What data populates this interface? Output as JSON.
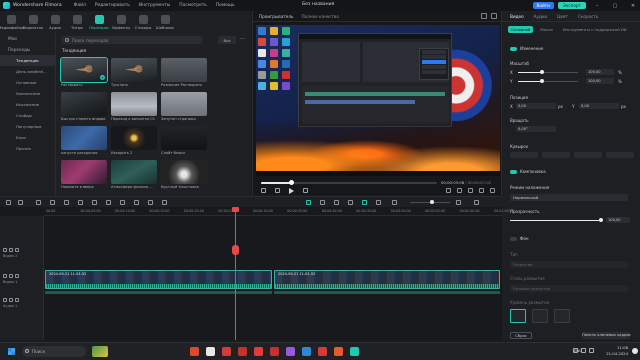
{
  "app": {
    "name": "Wondershare Filmora",
    "doc_title": "Без названия",
    "menu": [
      "Файл",
      "Редактировать",
      "Инструменты",
      "Посмотреть",
      "Помощь"
    ],
    "login_label": "Войти",
    "export_label": "Экспорт"
  },
  "tooltabs": [
    {
      "label": "Медиафайлы",
      "icon": "media-icon"
    },
    {
      "label": "Видеосток",
      "icon": "stock-icon"
    },
    {
      "label": "Аудио",
      "icon": "music-note-icon"
    },
    {
      "label": "Титры",
      "icon": "text-icon"
    },
    {
      "label": "Переходы",
      "icon": "transition-icon",
      "active": true
    },
    {
      "label": "Эффекты",
      "icon": "effects-icon"
    },
    {
      "label": "Стикеры",
      "icon": "sticker-icon"
    },
    {
      "label": "Шаблоны",
      "icon": "template-icon"
    }
  ],
  "sidebar": {
    "items": [
      {
        "label": "Мои",
        "sub": false
      },
      {
        "label": "Переходы",
        "sub": false
      },
      {
        "label": "Тенденция",
        "sub": true,
        "active": true
      },
      {
        "label": "День влюблё...",
        "sub": true
      },
      {
        "label": "Основные",
        "sub": true
      },
      {
        "label": "Увеличение",
        "sub": true
      },
      {
        "label": "Искажение",
        "sub": true
      },
      {
        "label": "Слайды",
        "sub": true
      },
      {
        "label": "Популярные",
        "sub": true
      },
      {
        "label": "Блок",
        "sub": true
      },
      {
        "label": "Прочее",
        "sub": true
      }
    ]
  },
  "media": {
    "search_placeholder": "Поиск переходов",
    "filter_label": "Все",
    "section_title": "Тенденция",
    "cards": [
      {
        "label": "Растворить",
        "style": "t-fly",
        "selected": true
      },
      {
        "label": "Тусклить",
        "style": "t-fly"
      },
      {
        "label": "Размытие Растворить",
        "style": "t-gray"
      },
      {
        "label": "Быстро стереть вправо",
        "style": "t-dark"
      },
      {
        "label": "Переход к виньетке 01",
        "style": "t-cloud"
      },
      {
        "label": "Запутан страница",
        "style": "t-light"
      },
      {
        "label": "капуста раскрытая",
        "style": "t-blue"
      },
      {
        "label": "Искорить 2",
        "style": "t-spark"
      },
      {
        "label": "Слайт блоки",
        "style": "t-dark2"
      },
      {
        "label": "Нажмите в вверх",
        "style": "t-pink"
      },
      {
        "label": "Атмосфера фильма ...",
        "style": "t-teal"
      },
      {
        "label": "Круглый Хлыстовка",
        "style": "t-glow"
      }
    ]
  },
  "player": {
    "tab_label": "Проигрыватель",
    "quality_label": "Полное качество",
    "progress": 0.17,
    "current_time": "00:00:03:06",
    "total_time": "00:00:07:02"
  },
  "rpanel": {
    "tabs": [
      "Видео",
      "Аудио",
      "Цвет",
      "Скорость"
    ],
    "subtabs": [
      "Основной",
      "Маска",
      "Инструменты с поддержкой ИИ"
    ],
    "transform_label": "Изменение",
    "scale_label": "Масштаб",
    "scale_x_label": "X",
    "scale_y_label": "Y",
    "scale_x_value": "100,00",
    "scale_y_value": "100,00",
    "scale_unit": "%",
    "position_label": "Позиция",
    "pos_x_label": "X",
    "pos_x_value": "0,00",
    "pos_y_label": "Y",
    "pos_y_value": "0,00",
    "pos_unit": "px",
    "rotate_label": "Вращать",
    "rotate_value": "0,00°",
    "flip_label": "Кувырок",
    "compositing_label": "Компоновка",
    "blend_label": "Режим наложения",
    "blend_value": "Нормальный",
    "opacity_label": "Прозрачность",
    "opacity_value": "100,00",
    "bg_label": "Фон",
    "type_label": "Тип",
    "type_value": "Размытие",
    "blur_style_label": "Стиль размытия",
    "blur_style_value": "Базовое размытие",
    "blur_level_label": "Уровень размытия",
    "reset_label": "Сброс",
    "keyframe_label": "Панель ключевых кадров"
  },
  "timeline": {
    "ticks": [
      "00:00",
      "00:00:05:00",
      "00:00:10:00",
      "00:00:15:00",
      "00:00:20:00",
      "00:00:25:00",
      "00:00:30:00",
      "00:00:35:00",
      "00:00:40:00",
      "00:00:45:00",
      "00:00:50:00",
      "00:00:55:00",
      "00:01:00:00",
      "00:01:05:00"
    ],
    "tracks": [
      {
        "label": "Видео 2",
        "icon": "video-track-icon"
      },
      {
        "label": "Видео 1",
        "icon": "video-track-icon"
      },
      {
        "label": "Аудио 1",
        "icon": "audio-track-icon"
      }
    ],
    "clips": [
      {
        "label": "2024-09-21 11-01-52"
      },
      {
        "label": "2024-09-21 11-01-52"
      }
    ]
  },
  "taskbar": {
    "search_label": "Поиск",
    "lang": "ENG",
    "time": "11:08",
    "date": "21.04.2024",
    "app_colors": [
      "#e04a2a",
      "#e8e8e8",
      "#d63a3a",
      "#c9302c",
      "#e23b3b",
      "#c9302c",
      "#9a5ae0",
      "#2a8ad6",
      "#d63a3a",
      "#e85a2a",
      "#22c8b0"
    ]
  }
}
